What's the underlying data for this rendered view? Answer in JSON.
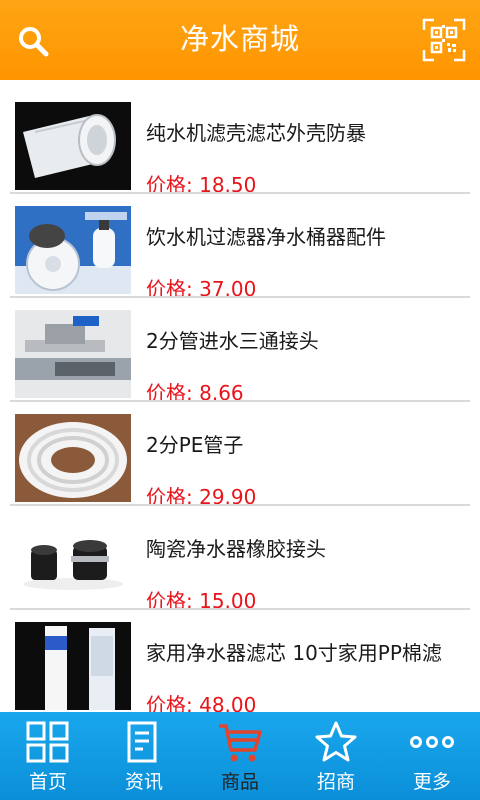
{
  "header": {
    "title": "净水商城",
    "search_icon": "search-icon",
    "scan_icon": "qr-scan-icon"
  },
  "colors": {
    "header": "#ff9f0f",
    "tabbar": "#139be2",
    "price": "#e8141b",
    "active_tab_icon": "#e2442c"
  },
  "products": [
    {
      "name": "纯水机滤壳滤芯外壳防暴",
      "price_label": "价格:",
      "price": "18.50"
    },
    {
      "name": "饮水机过滤器净水桶器配件",
      "price_label": "价格:",
      "price": "37.00"
    },
    {
      "name": "2分管进水三通接头",
      "price_label": "价格:",
      "price": "8.66"
    },
    {
      "name": "2分PE管子",
      "price_label": "价格:",
      "price": "29.90"
    },
    {
      "name": "陶瓷净水器橡胶接头",
      "price_label": "价格:",
      "price": "15.00"
    },
    {
      "name": "家用净水器滤芯 10寸家用PP棉滤",
      "price_label": "价格:",
      "price": "48.00"
    }
  ],
  "tabs": [
    {
      "label": "首页",
      "icon": "grid-home-icon"
    },
    {
      "label": "资讯",
      "icon": "news-document-icon"
    },
    {
      "label": "商品",
      "icon": "shopping-cart-icon",
      "active": true
    },
    {
      "label": "招商",
      "icon": "star-icon"
    },
    {
      "label": "更多",
      "icon": "more-dots-icon"
    }
  ]
}
